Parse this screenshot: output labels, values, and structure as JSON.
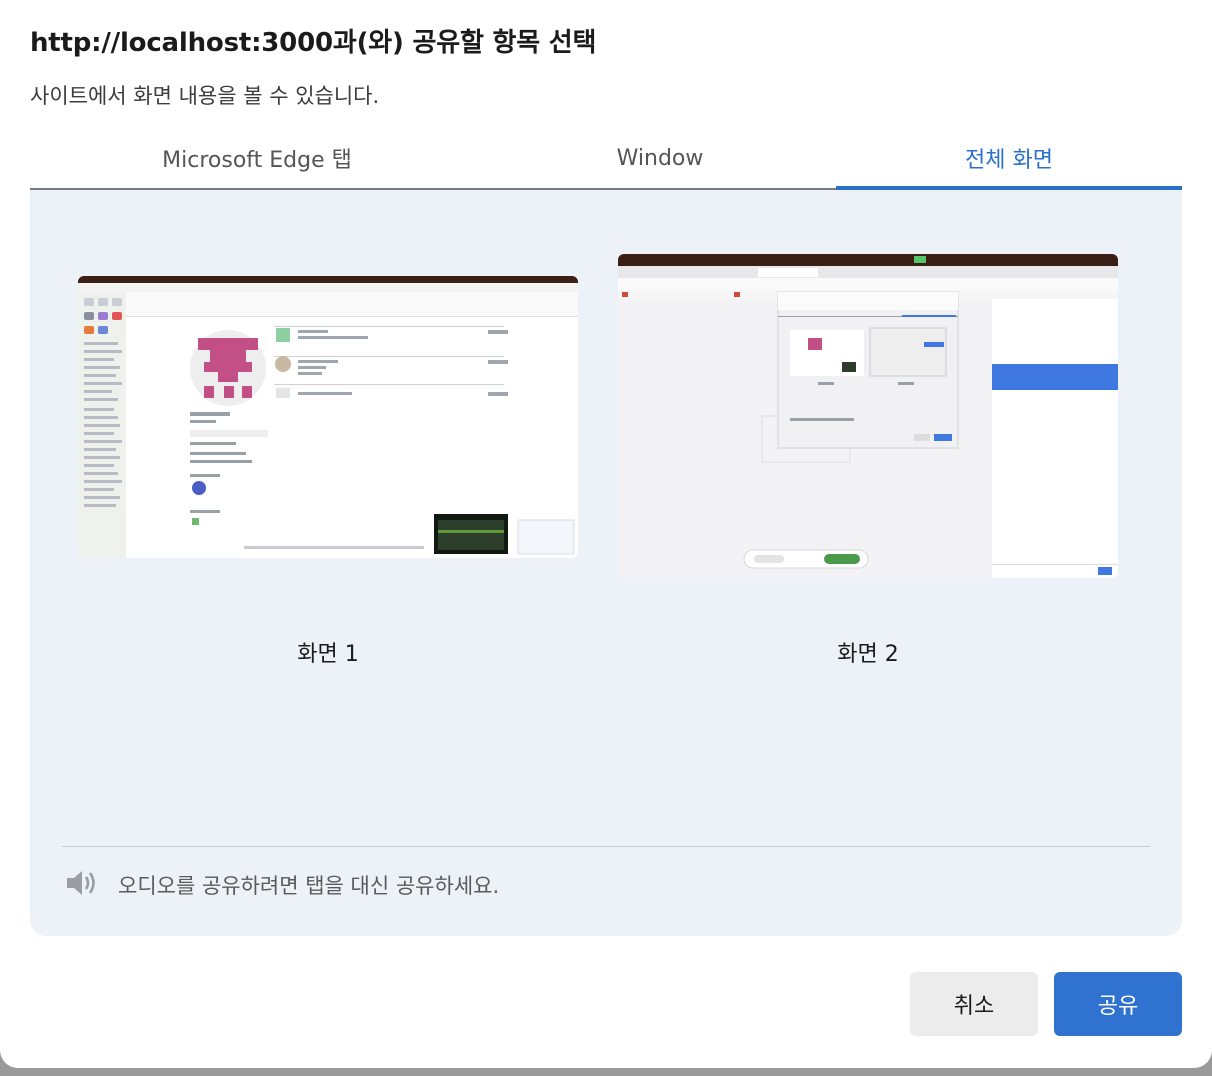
{
  "dialog": {
    "title": "http://localhost:3000과(와) 공유할 항목 선택",
    "subtitle": "사이트에서 화면 내용을 볼 수 있습니다."
  },
  "tabs": [
    {
      "label": "Microsoft Edge 탭"
    },
    {
      "label": "Window"
    },
    {
      "label": "전체 화면",
      "selected": true
    }
  ],
  "screens": [
    {
      "label": "화면 1"
    },
    {
      "label": "화면 2"
    }
  ],
  "audio_notice": {
    "icon": "speaker-icon",
    "text": "오디오를 공유하려면 탭을 대신 공유하세요."
  },
  "buttons": {
    "cancel": "취소",
    "share": "공유"
  },
  "colors": {
    "accent": "#2a70c8",
    "share_button": "#2f72cf",
    "panel": "#edf2f9"
  }
}
